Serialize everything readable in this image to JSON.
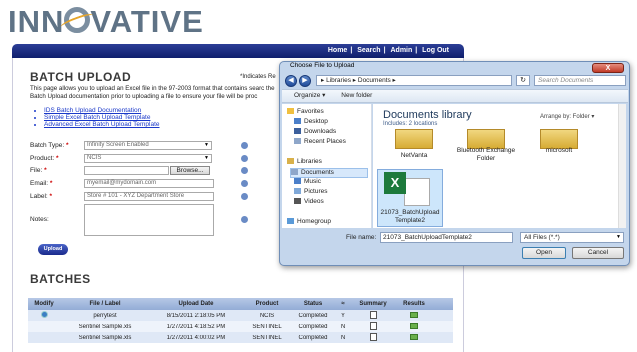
{
  "logo": {
    "prefix": "INN",
    "suffix": "VATIVE"
  },
  "nav": {
    "links": [
      "Home",
      "Search",
      "Admin",
      "Log Out"
    ]
  },
  "page": {
    "title": "BATCH UPLOAD",
    "required_note": "*Indicates Re",
    "intro": "This page allows you to upload an Excel file in the 97-2003 format that contains searc the Batch Upload documentation prior to uploading a file to ensure your file will be proc",
    "doc_links": [
      "IDS Batch Upload Documentation",
      "Simple Excel Batch Upload Template",
      "Advanced Excel Batch Upload Template"
    ]
  },
  "form": {
    "batch_type": {
      "label": "Batch Type:",
      "value": "Infinity Screen Enabled"
    },
    "product": {
      "label": "Product:",
      "value": "NCIS"
    },
    "file": {
      "label": "File:",
      "value": "",
      "browse": "Browse..."
    },
    "email": {
      "label": "Email:",
      "value": "myemail@mydomain.com"
    },
    "label": {
      "label": "Label:",
      "value": "Store # 101 - XYZ Department Store"
    },
    "notes": {
      "label": "Notes:",
      "value": ""
    },
    "upload_button": "Upload"
  },
  "batches": {
    "title": "BATCHES",
    "headers": [
      "Modify",
      "File / Label",
      "Upload Date",
      "Product",
      "Status",
      "≈",
      "Summary",
      "Results"
    ],
    "rows": [
      {
        "file": "perrytest",
        "date": "8/15/2011 2:18:05 PM",
        "product": "NCIS",
        "status": "Completed",
        "flag": "Y"
      },
      {
        "file": "Sentinel Sample.xls",
        "date": "1/27/2011 4:18:52 PM",
        "product": "SENTINEL",
        "status": "Completed",
        "flag": "N"
      },
      {
        "file": "Sentinel Sample.xls",
        "date": "1/27/2011 4:00:02 PM",
        "product": "SENTINEL",
        "status": "Completed",
        "flag": "N"
      }
    ]
  },
  "dialog": {
    "title": "Choose File to Upload",
    "close": "X",
    "address": "▸ Libraries ▸ Documents ▸",
    "search_placeholder": "Search Documents",
    "toolbar": {
      "organize": "Organize ▾",
      "new_folder": "New folder"
    },
    "sidebar": {
      "favorites": "Favorites",
      "items": [
        "Desktop",
        "Downloads",
        "Recent Places"
      ],
      "libraries": "Libraries",
      "lib_items": [
        "Documents",
        "Music",
        "Pictures",
        "Videos"
      ],
      "homegroup": "Homegroup"
    },
    "library_title": "Documents library",
    "library_sub": "Includes: 2 locations",
    "arrange_by": "Arrange by: Folder ▾",
    "folders": [
      "NetVanta",
      "Bluetooth Exchange Folder",
      "microsoft"
    ],
    "selected_file": "21073_BatchUploadTemplate2",
    "filename_label": "File name:",
    "filename_value": "21073_BatchUploadTemplate2",
    "filetype": "All Files (*.*)",
    "open": "Open",
    "cancel": "Cancel"
  }
}
